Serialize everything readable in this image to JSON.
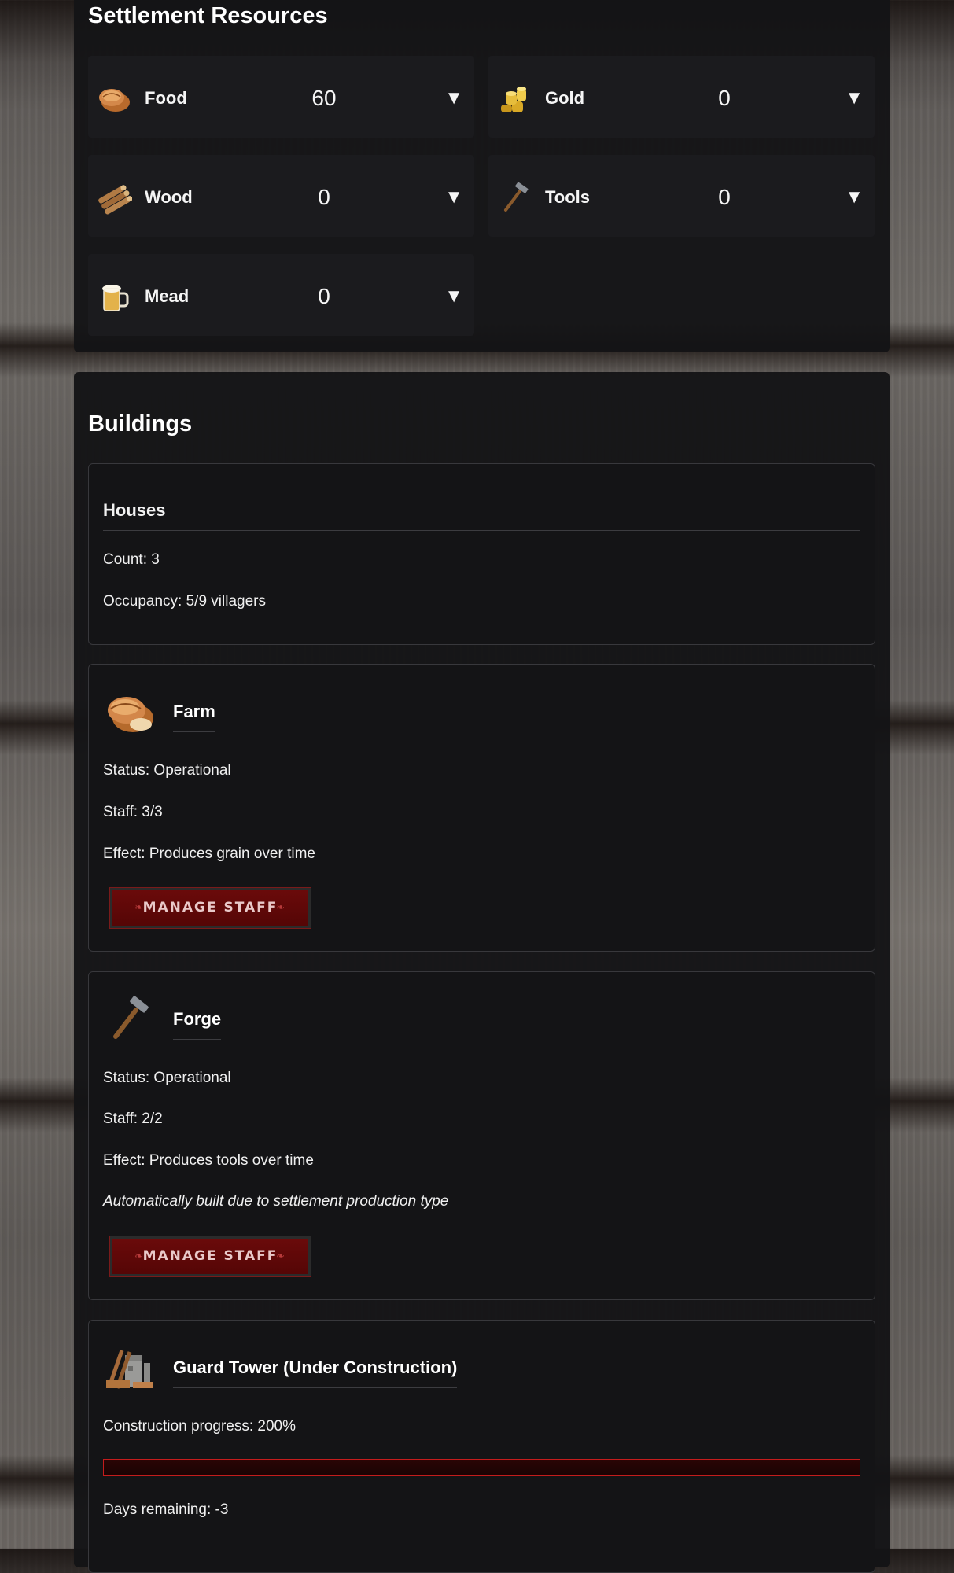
{
  "resources": {
    "title": "Settlement Resources",
    "items": [
      {
        "name": "Food",
        "value": "60",
        "icon": "bread-icon"
      },
      {
        "name": "Gold",
        "value": "0",
        "icon": "gold-coins-icon"
      },
      {
        "name": "Wood",
        "value": "0",
        "icon": "wood-logs-icon"
      },
      {
        "name": "Tools",
        "value": "0",
        "icon": "hammer-icon"
      },
      {
        "name": "Mead",
        "value": "0",
        "icon": "mead-mug-icon"
      }
    ],
    "toggle_glyph": "▼"
  },
  "buildings": {
    "title": "Buildings",
    "houses": {
      "title": "Houses",
      "count": "Count: 3",
      "occupancy": "Occupancy: 5/9 villagers"
    },
    "farm": {
      "title": "Farm",
      "status": "Status: Operational",
      "staff": "Staff: 3/3",
      "effect": "Effect: Produces grain over time",
      "button": "MANAGE STAFF",
      "icon": "bread-icon"
    },
    "forge": {
      "title": "Forge",
      "status": "Status: Operational",
      "staff": "Staff: 2/2",
      "effect": "Effect: Produces tools over time",
      "note": "Automatically built due to settlement production type",
      "button": "MANAGE STAFF",
      "icon": "hammer-icon"
    },
    "guard_tower": {
      "title": "Guard Tower (Under Construction)",
      "progress_text": "Construction progress: 200%",
      "progress": 2.0,
      "days": "Days remaining: -3",
      "icon": "construction-materials-icon"
    }
  },
  "colors": {
    "accent_red": "#6a0a0a",
    "progress_border": "#c41c1c",
    "panel_bg": "#141416"
  }
}
